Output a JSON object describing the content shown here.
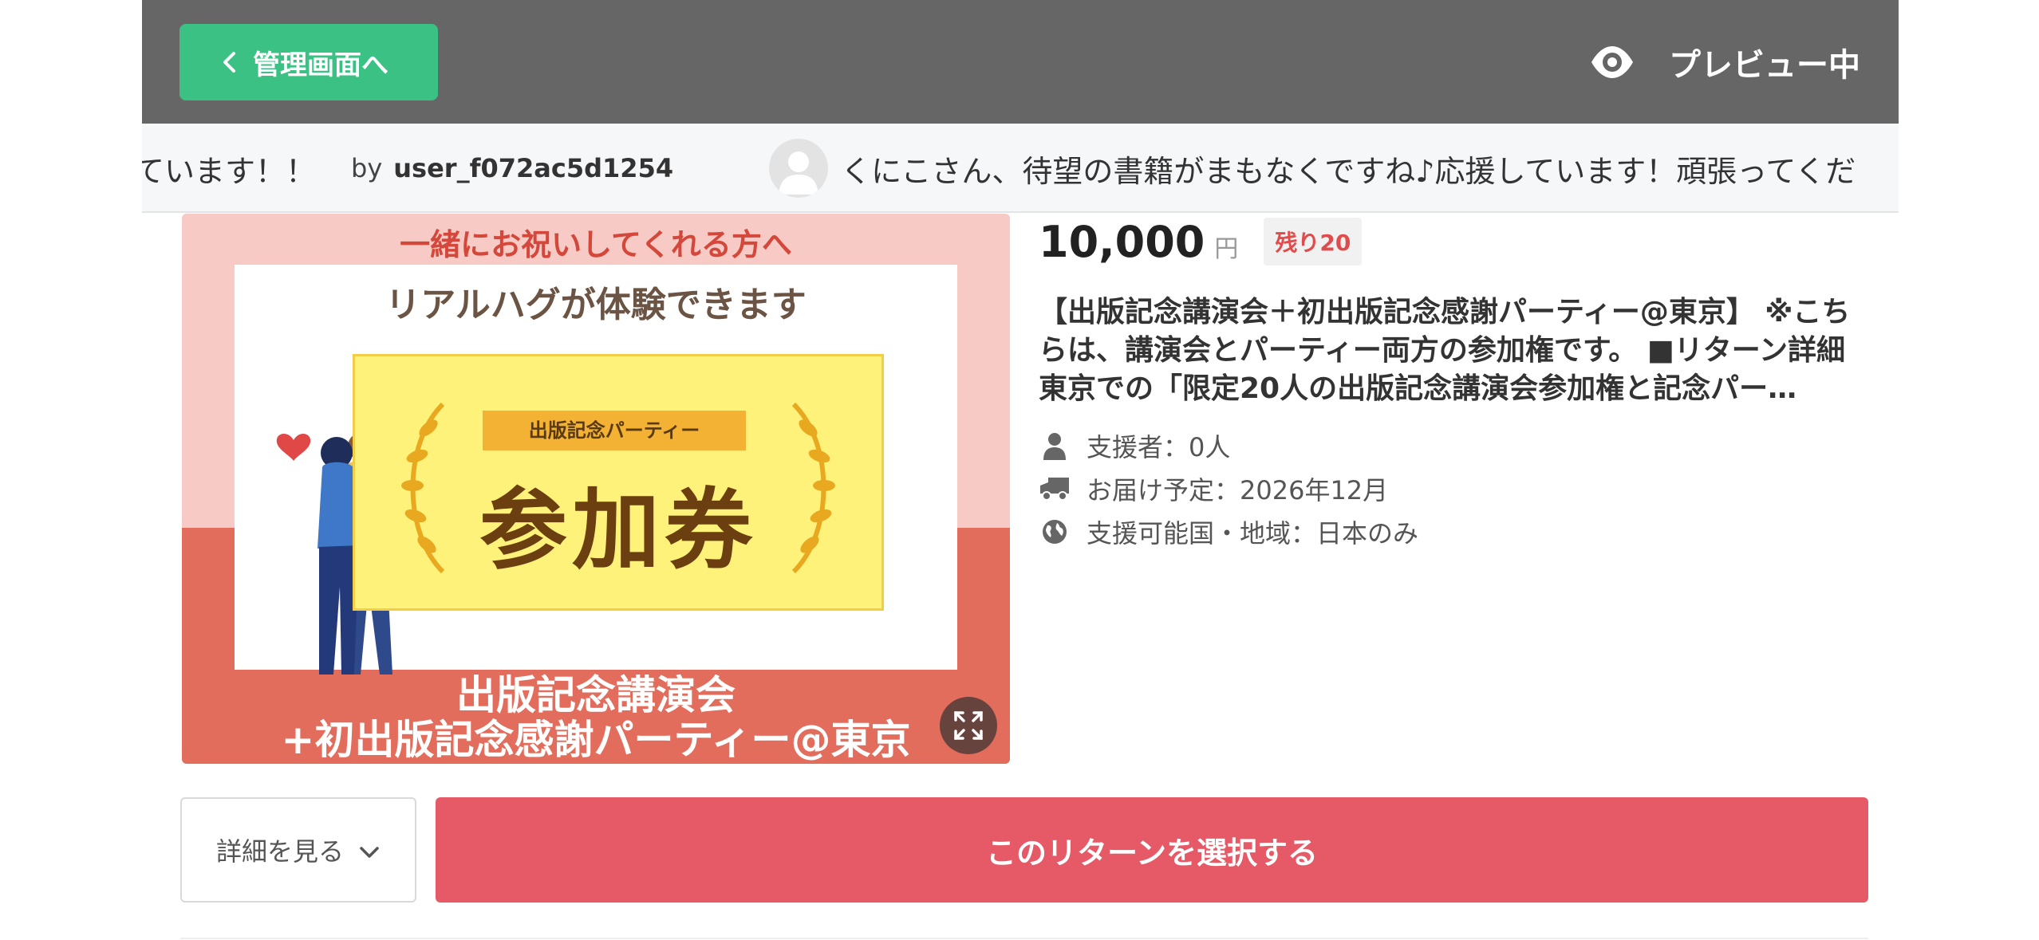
{
  "header": {
    "back_label": "管理画面へ",
    "preview_label": "プレビュー中"
  },
  "ticker": {
    "comment_tail": "ています！！",
    "by_label": "by",
    "username": "user_f072ac5d1254",
    "next_comment": "くにこさん、待望の書籍がまもなくですね♪応援しています！頑張ってくだ"
  },
  "return_image": {
    "top_text": "一緒にお祝いしてくれる方へ",
    "inner_title": "リアルハグが体験できます",
    "ribbon_text": "出版記念パーティー",
    "ticket_text": "参加券",
    "bottom_line1": "出版記念講演会",
    "bottom_line2": "+初出版記念感謝パーティー@東京"
  },
  "reward": {
    "price": "10,000",
    "currency": "円",
    "remaining": "残り20",
    "description": "【出版記念講演会＋初出版記念感謝パーティー@東京】 ※こちらは、講演会とパーティー両方の参加権です。 ■リターン詳細 東京での「限定20人の出版記念講演会参加権と記念パー…",
    "supporters": "支援者：0人",
    "delivery": "お届け予定：2026年12月",
    "region": "支援可能国・地域：日本のみ"
  },
  "actions": {
    "details_label": "詳細を見る",
    "select_label": "このリターンを選択する"
  },
  "colors": {
    "topbar": "#666666",
    "back_button": "#3bc184",
    "select_button": "#e55a66",
    "remaining_text": "#e04b4b"
  }
}
